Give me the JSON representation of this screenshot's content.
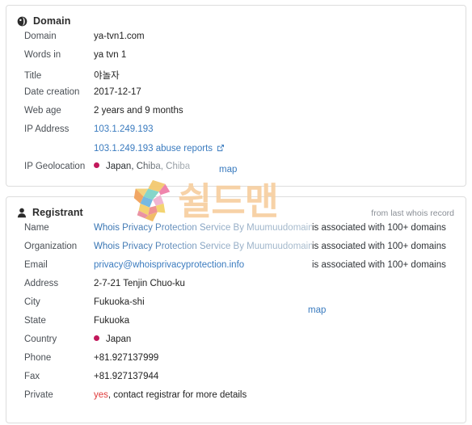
{
  "domain_panel": {
    "icon": "globe-icon",
    "title": "Domain",
    "rows": [
      {
        "label": "Domain",
        "value": "ya-tvn1.com"
      },
      {
        "label": "Words in",
        "value": "ya tvn 1"
      },
      {
        "label": "Title",
        "value": "야놀자"
      },
      {
        "label": "Date creation",
        "value": "2017-12-17"
      },
      {
        "label": "Web age",
        "value": "2 years and 9 months"
      },
      {
        "label": "IP Address",
        "value": "103.1.249.193"
      },
      {
        "label": "",
        "value": "103.1.249.193 abuse reports"
      },
      {
        "label": "IP Geolocation",
        "value": "Japan, Chiba, Chiba"
      }
    ],
    "abuse_reports_link": "103.1.249.193 abuse reports",
    "geolocation": "Japan, Chiba, Chiba",
    "map_link": "map"
  },
  "registrant_panel": {
    "icon": "user-icon",
    "title": "Registrant",
    "note": "from last whois record",
    "assoc_text": "is associated with 100+ domains",
    "rows": [
      {
        "label": "Name",
        "value": "Whois Privacy Protection Service By Muumuudomain"
      },
      {
        "label": "Organization",
        "value": "Whois Privacy Protection Service By Muumuudomain"
      },
      {
        "label": "Email",
        "value": "privacy@whoisprivacyprotection.info"
      },
      {
        "label": "Address",
        "value": "2-7-21 Tenjin Chuo-ku"
      },
      {
        "label": "City",
        "value": "Fukuoka-shi"
      },
      {
        "label": "State",
        "value": "Fukuoka"
      },
      {
        "label": "Country",
        "value": "Japan"
      },
      {
        "label": "Phone",
        "value": "+81.927137999"
      },
      {
        "label": "Fax",
        "value": "+81.927137944"
      },
      {
        "label": "Private",
        "value": "yes"
      }
    ],
    "private_yes": "yes",
    "private_rest": ", contact registrar for more details",
    "map_link": "map"
  },
  "watermark": {
    "logo_letter": "S",
    "text": "쉴드맨"
  },
  "colors": {
    "link": "#3a7bbf",
    "border": "#dddddd",
    "label": "#4a4f55",
    "value": "#222222",
    "red": "#e03b3b",
    "marker": "#c2185b",
    "watermark": "#f7cfa0"
  }
}
